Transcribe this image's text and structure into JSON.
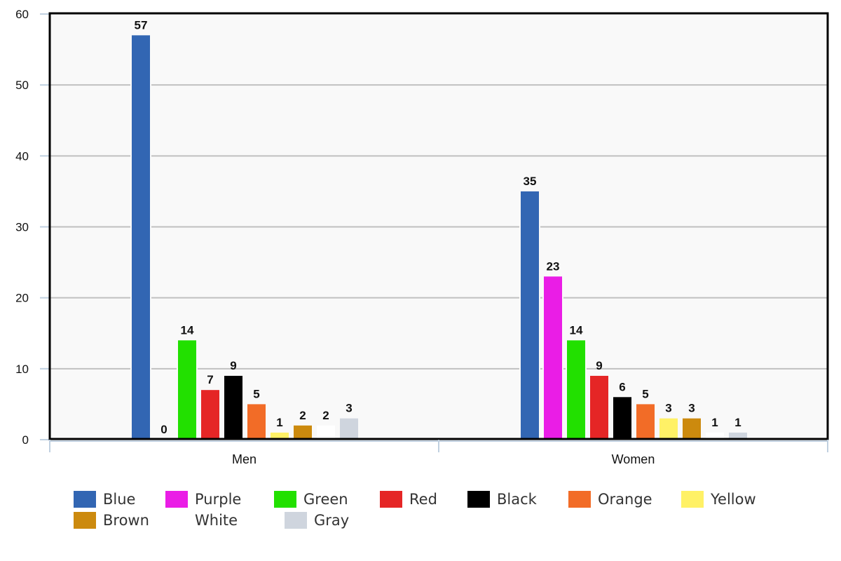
{
  "chart_data": {
    "type": "bar",
    "title": "",
    "xlabel": "",
    "ylabel": "",
    "categories": [
      "Men",
      "Women"
    ],
    "ylim": [
      0,
      60
    ],
    "yticks": [
      0,
      10,
      20,
      30,
      40,
      50,
      60
    ],
    "grid": true,
    "legend_position": "bottom",
    "series": [
      {
        "name": "Blue",
        "color": "#3266b3",
        "values": [
          57,
          35
        ]
      },
      {
        "name": "Purple",
        "color": "#ea1de6",
        "values": [
          0,
          23
        ]
      },
      {
        "name": "Green",
        "color": "#22e000",
        "values": [
          14,
          14
        ]
      },
      {
        "name": "Red",
        "color": "#e52626",
        "values": [
          7,
          9
        ]
      },
      {
        "name": "Black",
        "color": "#000000",
        "values": [
          9,
          6
        ]
      },
      {
        "name": "Orange",
        "color": "#f26c27",
        "values": [
          5,
          5
        ]
      },
      {
        "name": "Yellow",
        "color": "#fff166",
        "values": [
          1,
          3
        ]
      },
      {
        "name": "Brown",
        "color": "#cc8a0e",
        "values": [
          2,
          3
        ]
      },
      {
        "name": "White",
        "color": "#ffffff",
        "values": [
          2,
          1
        ]
      },
      {
        "name": "Gray",
        "color": "#cfd5de",
        "values": [
          3,
          1
        ]
      }
    ]
  }
}
